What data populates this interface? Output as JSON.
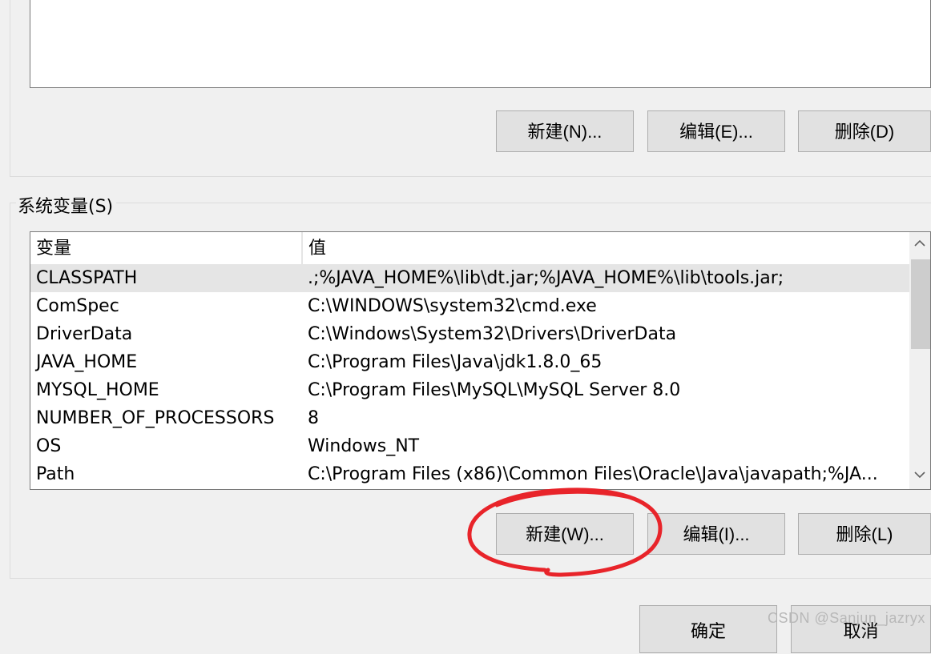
{
  "user_vars": {
    "buttons": {
      "new": "新建(N)...",
      "edit": "编辑(E)...",
      "delete": "删除(D)"
    }
  },
  "system_vars": {
    "group_title": "系统变量(S)",
    "columns": {
      "name": "变量",
      "value": "值"
    },
    "rows": [
      {
        "name": "CLASSPATH",
        "value": ".;%JAVA_HOME%\\lib\\dt.jar;%JAVA_HOME%\\lib\\tools.jar;",
        "selected": true
      },
      {
        "name": "ComSpec",
        "value": "C:\\WINDOWS\\system32\\cmd.exe"
      },
      {
        "name": "DriverData",
        "value": "C:\\Windows\\System32\\Drivers\\DriverData"
      },
      {
        "name": "JAVA_HOME",
        "value": "C:\\Program Files\\Java\\jdk1.8.0_65"
      },
      {
        "name": "MYSQL_HOME",
        "value": "C:\\Program Files\\MySQL\\MySQL Server 8.0"
      },
      {
        "name": "NUMBER_OF_PROCESSORS",
        "value": "8"
      },
      {
        "name": "OS",
        "value": "Windows_NT"
      },
      {
        "name": "Path",
        "value": "C:\\Program Files (x86)\\Common Files\\Oracle\\Java\\javapath;%JA..."
      }
    ],
    "buttons": {
      "new": "新建(W)...",
      "edit": "编辑(I)...",
      "delete": "删除(L)"
    }
  },
  "dialog_buttons": {
    "ok": "确定",
    "cancel": "取消"
  },
  "watermark": "CSDN @Sanjun_jazryx",
  "icons": {
    "scroll_up": "chevron-up-icon",
    "scroll_down": "chevron-down-icon"
  },
  "annotation_color": "#e8242a"
}
